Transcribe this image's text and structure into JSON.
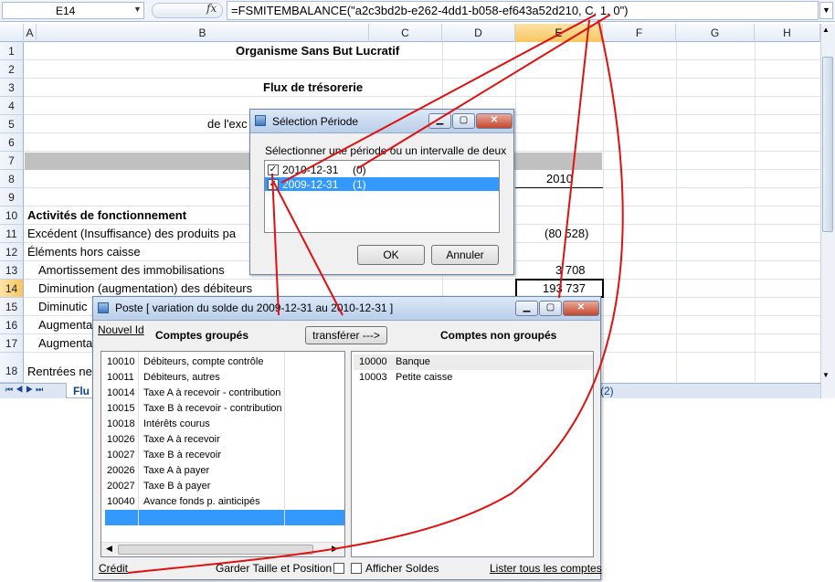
{
  "formula_bar": {
    "name_box": "E14",
    "fx": "fx",
    "formula": "=FSMITEMBALANCE(\"a2c3bd2b-e262-4dd1-b058-ef643a52d210, C, 1, 0\")"
  },
  "columns": [
    "A",
    "B",
    "C",
    "D",
    "E",
    "F",
    "G",
    "H"
  ],
  "selected_column": "E",
  "rows": [
    "1",
    "2",
    "3",
    "4",
    "5",
    "6",
    "7",
    "8",
    "9",
    "10",
    "11",
    "12",
    "13",
    "14",
    "15",
    "16",
    "17",
    "18"
  ],
  "selected_row": "14",
  "cells": {
    "r1_title": "Organisme Sans But Lucratif",
    "r3_title": "Flux de trésorerie",
    "r5_text": "de l'exc",
    "r8_year": "2010",
    "r10": "Activités de fonctionnement",
    "r11": "Excédent (Insuffisance) des produits pa",
    "r11_val": "(80 528)",
    "r12": "Éléments hors caisse",
    "r13": "Amortissement des immobilisations",
    "r13_val": "3 708",
    "r14": "Diminution (augmentation) des débiteurs",
    "r14_val": "193 737",
    "r15": "Diminutic",
    "r16": "Augmenta",
    "r17": "Augmenta",
    "r18": "Rentrées ne"
  },
  "sheet_tabs": {
    "label": "Flu",
    "page_count": "(2)"
  },
  "period_dialog": {
    "title": "Sélection Période",
    "prompt": "Sélectionner une période ou un intervalle de deux",
    "items": [
      {
        "date": "2010-12-31",
        "index": "(0)",
        "checked": true
      },
      {
        "date": "2009-12-31",
        "index": "(1)",
        "checked": true
      }
    ],
    "ok": "OK",
    "cancel": "Annuler"
  },
  "poste_dialog": {
    "title": "Poste  [ variation du solde du 2009-12-31 au 2010-12-31 ]",
    "new_id": "Nouvel Id",
    "grouped_header": "Comptes groupés",
    "transfer": "transférer --->",
    "ungrouped_header": "Comptes non groupés",
    "grouped": [
      {
        "code": "10010",
        "name": "Débiteurs, compte contrôle"
      },
      {
        "code": "10011",
        "name": "Débiteurs, autres"
      },
      {
        "code": "10014",
        "name": "Taxe A à recevoir - contribution"
      },
      {
        "code": "10015",
        "name": "Taxe B à recevoir - contribution"
      },
      {
        "code": "10018",
        "name": "Intérêts courus"
      },
      {
        "code": "10026",
        "name": "Taxe A à recevoir"
      },
      {
        "code": "10027",
        "name": "Taxe B à recevoir"
      },
      {
        "code": "20026",
        "name": "Taxe A à payer"
      },
      {
        "code": "20027",
        "name": "Taxe B à payer"
      },
      {
        "code": "10040",
        "name": "Avance fonds p. ainticipés"
      }
    ],
    "ungrouped": [
      {
        "code": "10000",
        "name": "Banque"
      },
      {
        "code": "10003",
        "name": "Petite caisse"
      }
    ],
    "credit": "Crédit",
    "keep_size": "Garder Taille et Position",
    "show_balances": "Afficher Soldes",
    "list_all": "Lister tous les comptes"
  },
  "colors": {
    "annotation": "#e01010",
    "selection": "#3399ff",
    "header_sel": "#f9c65e"
  }
}
